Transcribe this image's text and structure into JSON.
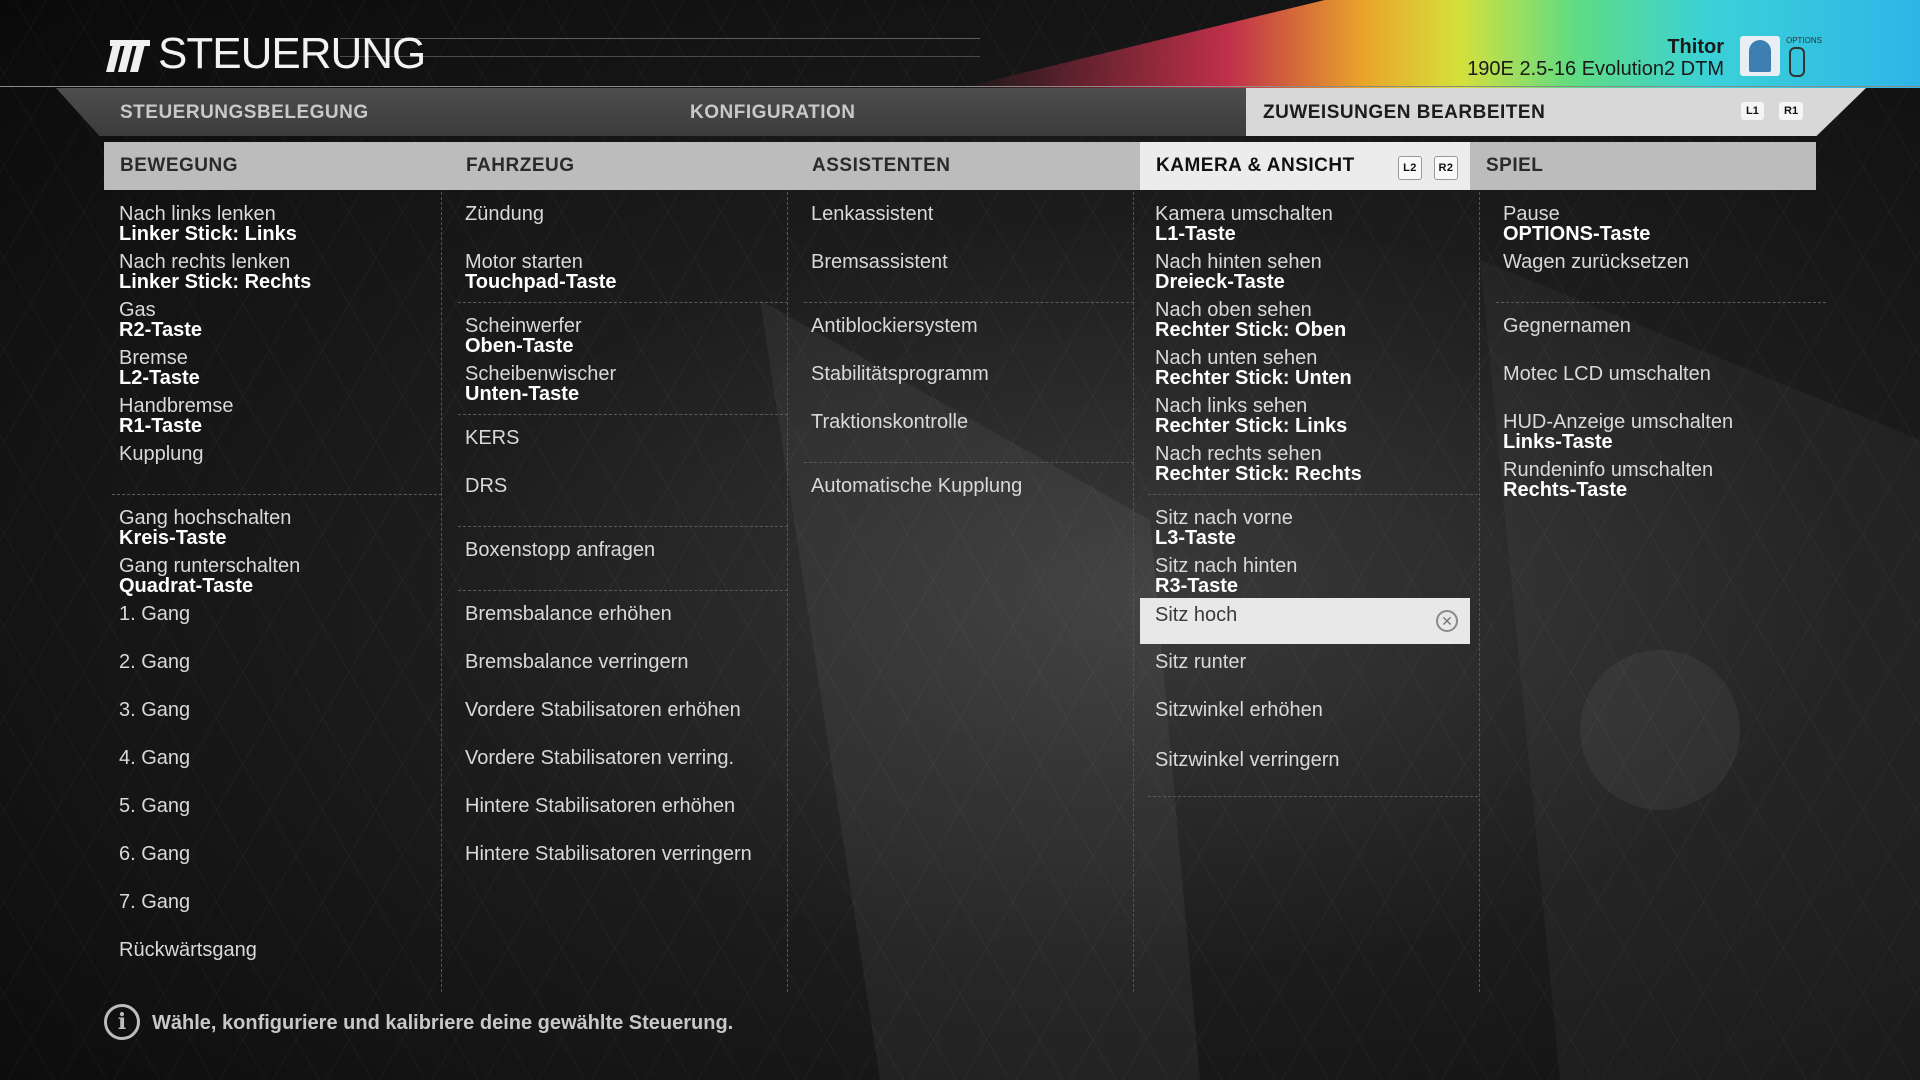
{
  "header": {
    "title": "STEUERUNG",
    "user_name": "Thitor",
    "car_name": "190E 2.5-16 Evolution2 DTM",
    "options_label": "OPTIONS"
  },
  "tabs": {
    "items": [
      "STEUERUNGSBELEGUNG",
      "KONFIGURATION",
      "ZUWEISUNGEN BEARBEITEN"
    ],
    "active": "ZUWEISUNGEN BEARBEITEN",
    "shoulder_left": "L1",
    "shoulder_right": "R1"
  },
  "columns": {
    "bewegung": {
      "header": "BEWEGUNG",
      "items": [
        {
          "label": "Nach links lenken",
          "key": "Linker Stick: Links"
        },
        {
          "label": "Nach rechts lenken",
          "key": "Linker Stick: Rechts"
        },
        {
          "label": "Gas",
          "key": "R2-Taste"
        },
        {
          "label": "Bremse",
          "key": "L2-Taste"
        },
        {
          "label": "Handbremse",
          "key": "R1-Taste"
        },
        {
          "label": "Kupplung",
          "key": ""
        },
        {
          "label": "Gang hochschalten",
          "key": "Kreis-Taste"
        },
        {
          "label": "Gang runterschalten",
          "key": "Quadrat-Taste"
        },
        {
          "label": "1. Gang",
          "key": ""
        },
        {
          "label": "2. Gang",
          "key": ""
        },
        {
          "label": "3. Gang",
          "key": ""
        },
        {
          "label": "4. Gang",
          "key": ""
        },
        {
          "label": "5. Gang",
          "key": ""
        },
        {
          "label": "6. Gang",
          "key": ""
        },
        {
          "label": "7. Gang",
          "key": ""
        },
        {
          "label": "Rückwärtsgang",
          "key": ""
        }
      ]
    },
    "fahrzeug": {
      "header": "FAHRZEUG",
      "items": [
        {
          "label": "Zündung",
          "key": ""
        },
        {
          "label": "Motor starten",
          "key": "Touchpad-Taste"
        },
        {
          "label": "Scheinwerfer",
          "key": "Oben-Taste"
        },
        {
          "label": "Scheibenwischer",
          "key": "Unten-Taste"
        },
        {
          "label": "KERS",
          "key": ""
        },
        {
          "label": "DRS",
          "key": ""
        },
        {
          "label": "Boxenstopp anfragen",
          "key": ""
        },
        {
          "label": "Bremsbalance erhöhen",
          "key": ""
        },
        {
          "label": "Bremsbalance verringern",
          "key": ""
        },
        {
          "label": "Vordere Stabilisatoren erhöhen",
          "key": ""
        },
        {
          "label": "Vordere Stabilisatoren verring.",
          "key": ""
        },
        {
          "label": "Hintere Stabilisatoren erhöhen",
          "key": ""
        },
        {
          "label": "Hintere Stabilisatoren verringern",
          "key": ""
        }
      ]
    },
    "assistenten": {
      "header": "ASSISTENTEN",
      "items": [
        {
          "label": "Lenkassistent",
          "key": ""
        },
        {
          "label": "Bremsassistent",
          "key": ""
        },
        {
          "label": "Antiblockiersystem",
          "key": ""
        },
        {
          "label": "Stabilitätsprogramm",
          "key": ""
        },
        {
          "label": "Traktionskontrolle",
          "key": ""
        },
        {
          "label": "Automatische Kupplung",
          "key": ""
        }
      ]
    },
    "kamera": {
      "header": "KAMERA & ANSICHT",
      "lr_left": "L2",
      "lr_right": "R2",
      "items": [
        {
          "label": "Kamera umschalten",
          "key": "L1-Taste"
        },
        {
          "label": "Nach hinten sehen",
          "key": "Dreieck-Taste"
        },
        {
          "label": "Nach oben sehen",
          "key": "Rechter Stick: Oben"
        },
        {
          "label": "Nach unten sehen",
          "key": "Rechter Stick: Unten"
        },
        {
          "label": "Nach links sehen",
          "key": "Rechter Stick: Links"
        },
        {
          "label": "Nach rechts sehen",
          "key": "Rechter Stick: Rechts"
        },
        {
          "label": "Sitz nach vorne",
          "key": "L3-Taste"
        },
        {
          "label": "Sitz nach hinten",
          "key": "R3-Taste"
        },
        {
          "label": "Sitz hoch",
          "key": ""
        },
        {
          "label": "Sitz runter",
          "key": ""
        },
        {
          "label": "Sitzwinkel erhöhen",
          "key": ""
        },
        {
          "label": "Sitzwinkel verringern",
          "key": ""
        }
      ]
    },
    "spiel": {
      "header": "SPIEL",
      "items": [
        {
          "label": "Pause",
          "key": "OPTIONS-Taste"
        },
        {
          "label": "Wagen zurücksetzen",
          "key": ""
        },
        {
          "label": "Gegnernamen",
          "key": ""
        },
        {
          "label": "Motec LCD umschalten",
          "key": ""
        },
        {
          "label": "HUD-Anzeige umschalten",
          "key": "Links-Taste"
        },
        {
          "label": "Rundeninfo umschalten",
          "key": "Rechts-Taste"
        }
      ]
    }
  },
  "selected_item": "Sitz hoch",
  "footer": {
    "info_text": "Wähle, konfiguriere und kalibriere deine gewählte Steuerung."
  },
  "colors": {
    "active_tab": "#d8d8d8",
    "column_header_bar": "#bcbcbc",
    "selected_row": "#e8e8e8"
  }
}
